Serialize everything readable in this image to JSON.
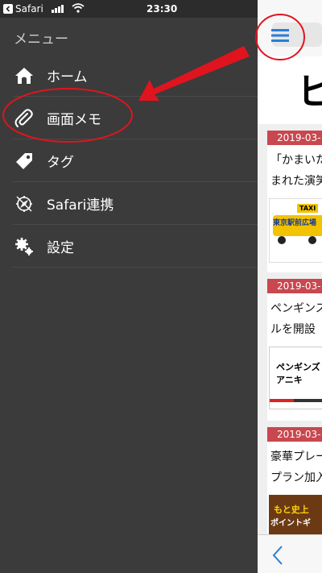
{
  "status_bar": {
    "back_app": "Safari",
    "time": "23:30"
  },
  "menu": {
    "title": "メニュー",
    "items": [
      {
        "label": "ホーム",
        "icon": "home-icon"
      },
      {
        "label": "画面メモ",
        "icon": "paperclip-icon"
      },
      {
        "label": "タグ",
        "icon": "tag-icon"
      },
      {
        "label": "Safari連携",
        "icon": "compass-icon"
      },
      {
        "label": "設定",
        "icon": "gears-icon"
      }
    ]
  },
  "right_app": {
    "logo_char": "ヒ",
    "articles": [
      {
        "date": "2019-03-",
        "title_line1": "「かまいた",
        "title_line2": "まれた演笑"
      },
      {
        "date": "2019-03-",
        "title_line1": "ペンギンス",
        "title_line2": "ルを開設"
      },
      {
        "date": "2019-03-",
        "title_line1": "豪華プレー",
        "title_line2": "プラン加入"
      }
    ],
    "thumbs": [
      {
        "badge": "TAXI",
        "text": "東京駅前広場"
      },
      {
        "text_line1": "ペンギンズ",
        "text_line2": "アニキ"
      },
      {
        "text_line1": "もと史上",
        "text_line2": "ポイントギ"
      }
    ]
  },
  "colors": {
    "menu_bg": "#3b3b3b",
    "date_badge": "#c9474e",
    "annotation_red": "#e0141e",
    "link_blue": "#2a7cd8"
  }
}
